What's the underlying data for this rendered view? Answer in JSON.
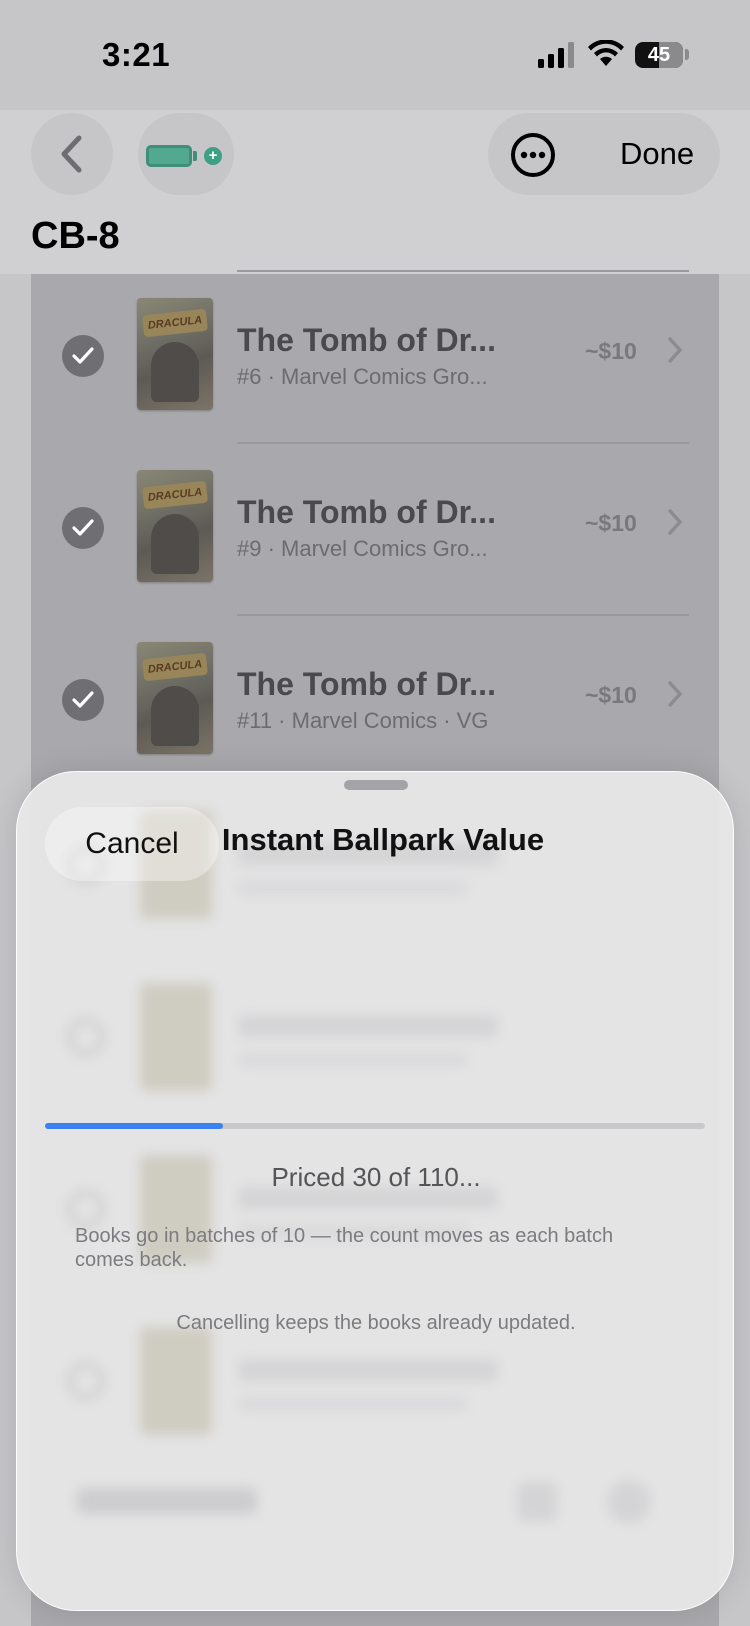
{
  "status_bar": {
    "time": "3:21",
    "battery": "45"
  },
  "nav": {
    "title": "CB-8",
    "done_label": "Done"
  },
  "colors": {
    "accent": "#3b82f0",
    "battery_green": "#52a98f"
  },
  "list": {
    "rows": [
      {
        "title": "The Tomb of Dr...",
        "subtitle": "#6 · Marvel Comics Gro...",
        "price": "~$10",
        "cover_text": "DRACULA"
      },
      {
        "title": "The Tomb of Dr...",
        "subtitle": "#9 · Marvel Comics Gro...",
        "price": "~$10",
        "cover_text": "DRACULA"
      },
      {
        "title": "The Tomb of Dr...",
        "subtitle": "#11 · Marvel Comics · VG",
        "price": "~$10",
        "cover_text": "DRACULA"
      }
    ]
  },
  "sheet": {
    "cancel_label": "Cancel",
    "title": "Instant Ballpark Value",
    "progress": {
      "done": 30,
      "total": 110,
      "fraction": 0.27
    },
    "status": "Priced 30 of 110...",
    "batch_note": "Books go in batches of 10 — the count moves as each batch comes back.",
    "cancel_note": "Cancelling keeps the books already updated."
  },
  "icons": {
    "back": "chevron-left-icon",
    "battery_add": "battery-plus-icon",
    "more": "ellipsis-circle-icon",
    "check": "checkmark-circle-icon",
    "chevron": "chevron-right-icon"
  }
}
